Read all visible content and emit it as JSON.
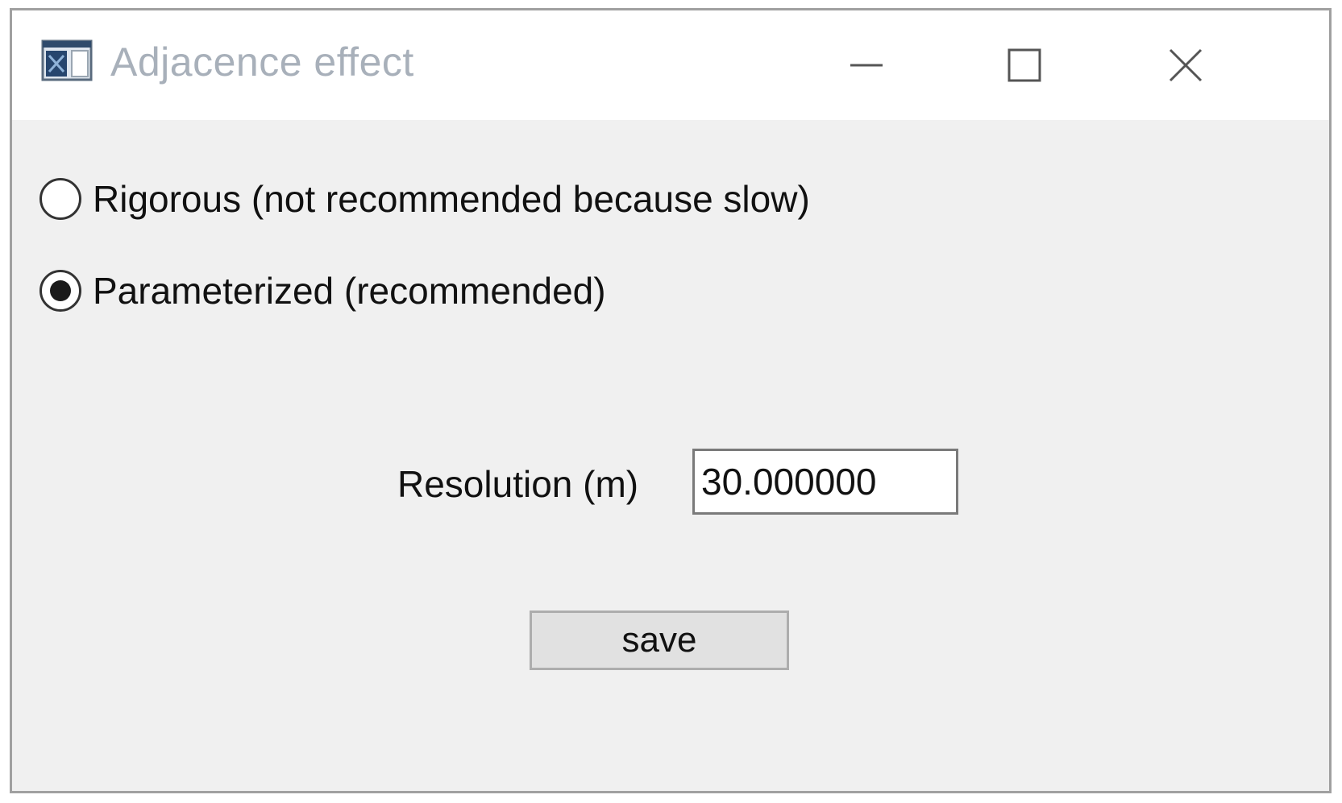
{
  "window": {
    "title": "Adjacence effect",
    "icon": "app-window-icon",
    "controls": {
      "minimize_icon": "minimize-icon",
      "maximize_icon": "maximize-icon",
      "close_icon": "close-icon"
    }
  },
  "options": {
    "rigorous": {
      "label": "Rigorous (not recommended because slow)",
      "selected": false
    },
    "parameterized": {
      "label": "Parameterized (recommended)",
      "selected": true
    }
  },
  "resolution": {
    "label": "Resolution (m)",
    "value": "30.000000"
  },
  "actions": {
    "save_label": "save"
  },
  "colors": {
    "title_text": "#a8b0ba",
    "dialog_background": "#f0f0f0",
    "button_background": "#e1e1e1"
  }
}
